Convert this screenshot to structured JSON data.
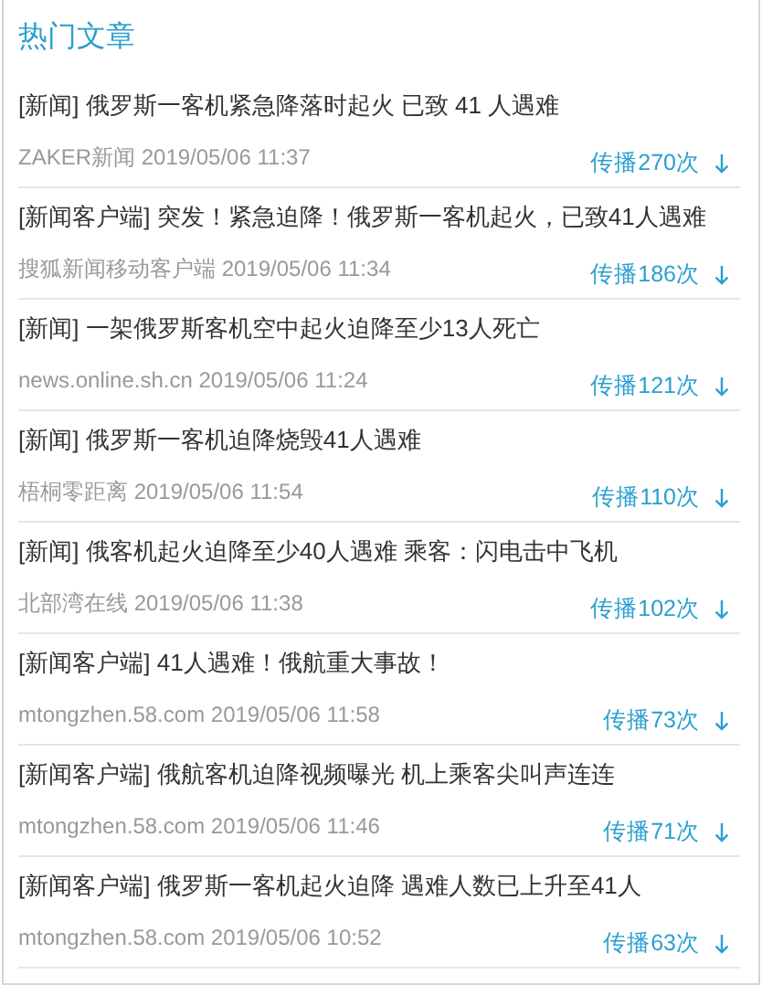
{
  "heading": "热门文章",
  "articles": [
    {
      "title": "[新闻] 俄罗斯一客机紧急降落时起火 已致 41 人遇难",
      "source": "ZAKER新闻 2019/05/06 11:37",
      "spread": "传播270次"
    },
    {
      "title": "[新闻客户端] 突发！紧急迫降！俄罗斯一客机起火，已致41人遇难",
      "source": "搜狐新闻移动客户端 2019/05/06 11:34",
      "spread": "传播186次"
    },
    {
      "title": "[新闻] 一架俄罗斯客机空中起火迫降至少13人死亡",
      "source": "news.online.sh.cn 2019/05/06 11:24",
      "spread": "传播121次"
    },
    {
      "title": "[新闻] 俄罗斯一客机迫降烧毁41人遇难",
      "source": "梧桐零距离 2019/05/06 11:54",
      "spread": "传播110次"
    },
    {
      "title": "[新闻] 俄客机起火迫降至少40人遇难 乘客：闪电击中飞机",
      "source": "北部湾在线 2019/05/06 11:38",
      "spread": "传播102次"
    },
    {
      "title": "[新闻客户端] 41人遇难！俄航重大事故！",
      "source": "mtongzhen.58.com 2019/05/06 11:58",
      "spread": "传播73次"
    },
    {
      "title": "[新闻客户端] 俄航客机迫降视频曝光 机上乘客尖叫声连连",
      "source": "mtongzhen.58.com 2019/05/06 11:46",
      "spread": "传播71次"
    },
    {
      "title": "[新闻客户端] 俄罗斯一客机起火迫降 遇难人数已上升至41人",
      "source": "mtongzhen.58.com 2019/05/06 10:52",
      "spread": "传播63次"
    }
  ]
}
